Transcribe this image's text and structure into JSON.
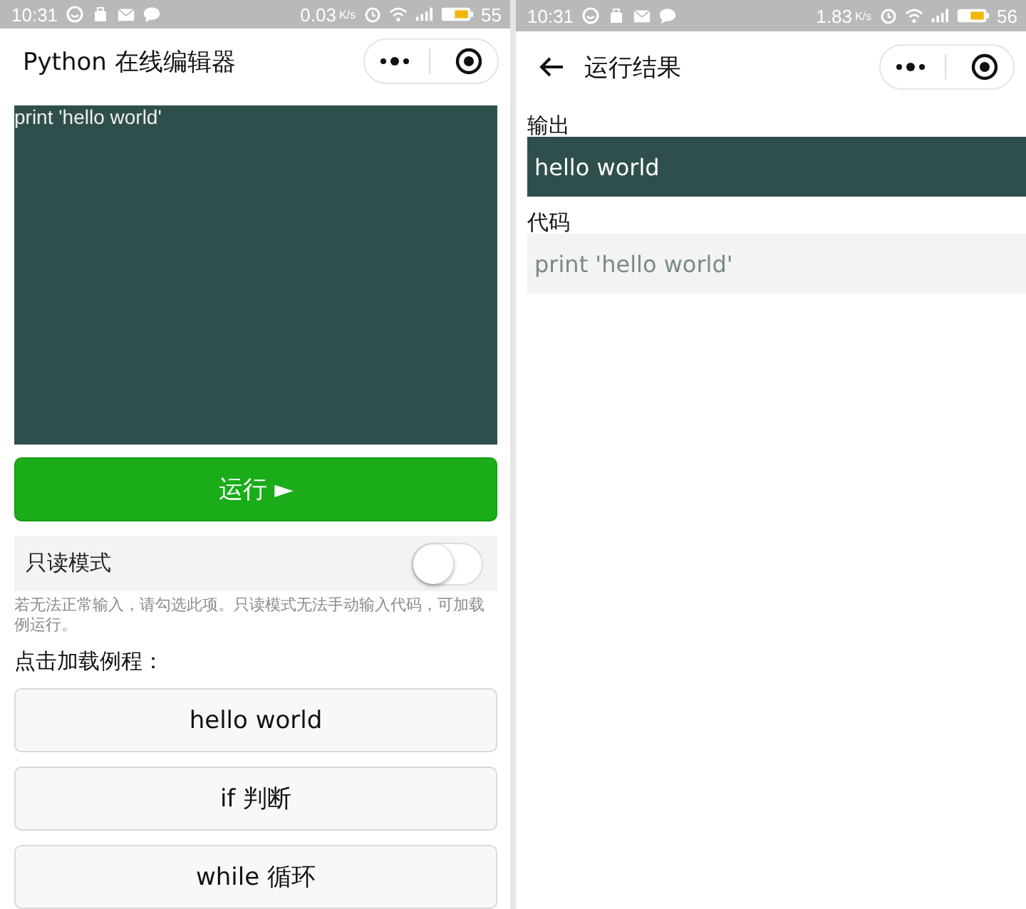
{
  "screens": [
    {
      "status_bar": {
        "time": "10:31",
        "speed": "0.03",
        "speed_unit": "K/s",
        "battery": "55"
      },
      "nav": {
        "title": "Python 在线编辑器",
        "back": false
      },
      "editor": {
        "code": "print 'hello world'"
      },
      "run_button": {
        "label": "运行 ►"
      },
      "readonly": {
        "label": "只读模式",
        "on": false
      },
      "hint": "若无法正常输入，请勾选此项。只读模式无法手动输入代码，可加载例运行。",
      "examples_label": "点击加载例程：",
      "examples": [
        "hello world",
        "if 判断",
        "while 循环"
      ]
    },
    {
      "status_bar": {
        "time": "10:31",
        "speed": "1.83",
        "speed_unit": "K/s",
        "battery": "56"
      },
      "nav": {
        "title": "运行结果",
        "back": true
      },
      "output_label": "输出",
      "output": "hello world",
      "code_label": "代码",
      "code": "print 'hello world'"
    }
  ]
}
